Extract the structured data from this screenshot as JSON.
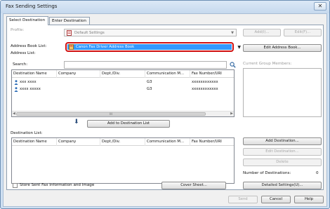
{
  "window": {
    "title": "Fax Sending Settings",
    "close_glyph": "✕"
  },
  "tabs": [
    {
      "label": "Select Destination"
    },
    {
      "label": "Enter Destination"
    }
  ],
  "profile": {
    "label": "Profile:",
    "value": "Default Settings",
    "add_label": "Add(I)...",
    "edit_label": "Edit(F)..."
  },
  "address_book": {
    "label": "Address Book List:",
    "value": "Canon Fax Driver Address Book",
    "edit_label": "Edit Address Book..."
  },
  "address_list": {
    "label": "Address List:",
    "search_label": "Search:",
    "columns": [
      "Destination Name",
      "Company",
      "Dept./Div.",
      "Communication M...",
      "Fax Number/URI"
    ],
    "rows": [
      {
        "name": "xxx xxxx",
        "company": "",
        "dept": "",
        "comm": "G3",
        "fax": "xxxxxxxxxxxx"
      },
      {
        "name": "xxxx xxxxx",
        "company": "",
        "dept": "",
        "comm": "G3",
        "fax": "xxxxxxxxxxxx"
      }
    ],
    "scroll_thumb": "III"
  },
  "group_members": {
    "label": "Current Group Members:"
  },
  "add_to_destination_label": "Add to Destination List",
  "down_arrow": "⬇",
  "destination_list": {
    "label": "Destination List:",
    "columns": [
      "Destination Name",
      "Company",
      "Dept./Div.",
      "Communication M...",
      "Fax Number/URI"
    ]
  },
  "side_buttons": {
    "add_destination": "Add Destination...",
    "edit_destination": "Edit Destination...",
    "delete": "Delete"
  },
  "number_of_destinations": {
    "label": "Number of Destinations:",
    "value": "0"
  },
  "store_info_label": "Store Sent Fax Information and Image",
  "cover_sheet_label": "Cover Sheet...",
  "detailed_settings_label": "Detailed Settings(U)...",
  "footer": {
    "send": "Send",
    "cancel": "Cancel",
    "help": "Help"
  },
  "colors": {
    "accent": "#3399ff",
    "highlight": "#d01010"
  }
}
